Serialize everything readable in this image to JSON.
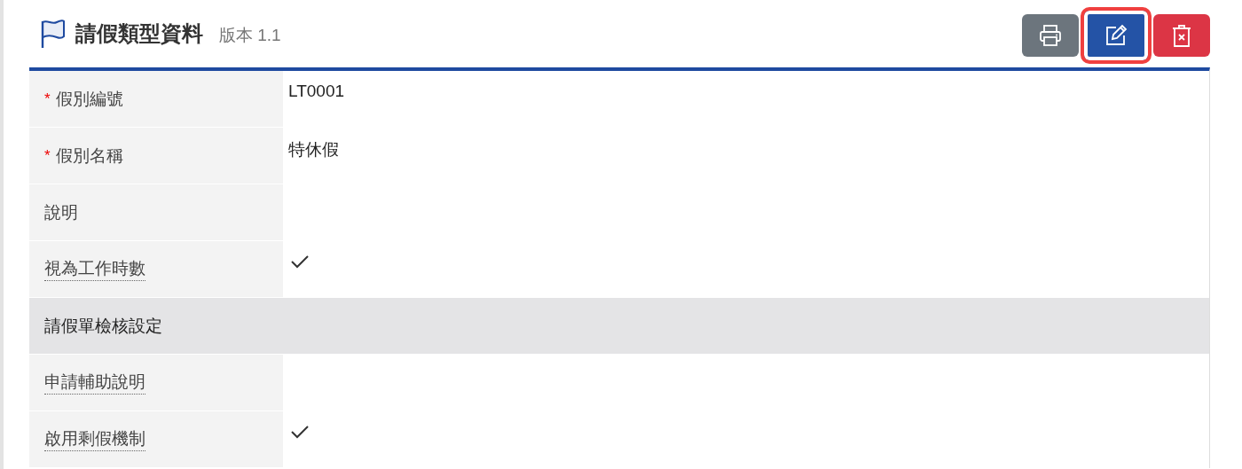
{
  "header": {
    "title": "請假類型資料",
    "version": "版本 1.1"
  },
  "buttons": [
    {
      "kind": "print",
      "focused": false
    },
    {
      "kind": "edit",
      "focused": true
    },
    {
      "kind": "delete",
      "focused": false
    }
  ],
  "rows": [
    {
      "kind": "text",
      "label": "假別編號",
      "required": "*",
      "hint": false,
      "value": "LT0001"
    },
    {
      "kind": "text",
      "label": "假別名稱",
      "required": "*",
      "hint": false,
      "value": "特休假"
    },
    {
      "kind": "text",
      "label": "說明",
      "hint": false
    },
    {
      "kind": "check",
      "label": "視為工作時數",
      "hint": true,
      "checked": true
    },
    {
      "kind": "section",
      "label": "請假單檢核設定"
    },
    {
      "kind": "text",
      "label": "申請輔助說明",
      "hint": true
    },
    {
      "kind": "check",
      "label": "啟用剩假機制",
      "hint": true,
      "checked": true
    }
  ]
}
